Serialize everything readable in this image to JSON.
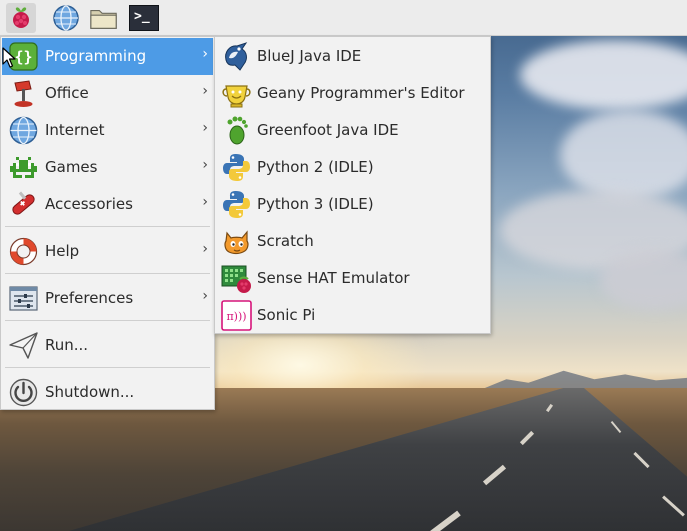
{
  "panel": {
    "buttons": [
      {
        "icon": "raspberry-icon",
        "tooltip": ""
      },
      {
        "icon": "globe-icon",
        "tooltip": ""
      },
      {
        "icon": "folder-icon",
        "tooltip": ""
      },
      {
        "icon": "terminal-icon",
        "tooltip": ""
      }
    ],
    "terminal_glyph": ">_"
  },
  "main_menu": {
    "items": [
      {
        "label": "Programming",
        "icon": "programming-icon",
        "has_submenu": true,
        "highlighted": true
      },
      {
        "label": "Office",
        "icon": "office-icon",
        "has_submenu": true
      },
      {
        "label": "Internet",
        "icon": "internet-icon",
        "has_submenu": true
      },
      {
        "label": "Games",
        "icon": "games-icon",
        "has_submenu": true
      },
      {
        "label": "Accessories",
        "icon": "accessories-icon",
        "has_submenu": true
      },
      {
        "label": "Help",
        "icon": "help-icon",
        "has_submenu": true
      },
      {
        "label": "Preferences",
        "icon": "preferences-icon",
        "has_submenu": true
      },
      {
        "label": "Run...",
        "icon": "run-icon",
        "has_submenu": false
      },
      {
        "label": "Shutdown...",
        "icon": "shutdown-icon",
        "has_submenu": false
      }
    ],
    "submenu_arrow": "›",
    "programming_glyph": "{}"
  },
  "sub_menu": {
    "items": [
      {
        "label": "BlueJ Java IDE",
        "icon": "bluej-icon"
      },
      {
        "label": "Geany Programmer's Editor",
        "icon": "geany-icon"
      },
      {
        "label": "Greenfoot Java IDE",
        "icon": "greenfoot-icon"
      },
      {
        "label": "Python 2 (IDLE)",
        "icon": "python-icon"
      },
      {
        "label": "Python 3 (IDLE)",
        "icon": "python-icon"
      },
      {
        "label": "Scratch",
        "icon": "scratch-icon"
      },
      {
        "label": "Sense HAT Emulator",
        "icon": "sense-hat-icon"
      },
      {
        "label": "Sonic Pi",
        "icon": "sonic-pi-icon"
      }
    ],
    "sonic_pi_glyph": "π)))"
  },
  "colors": {
    "highlight": "#4d9be6",
    "menu_bg": "#f2f2f2",
    "panel_bg": "#ececec"
  }
}
